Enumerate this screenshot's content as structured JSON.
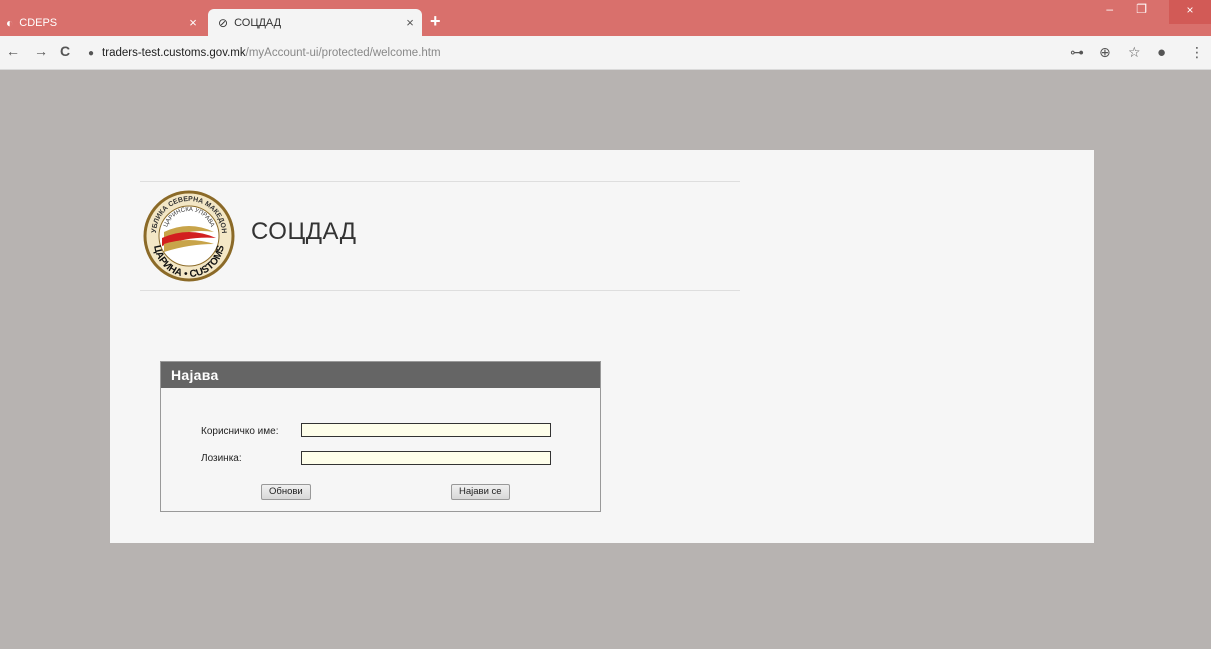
{
  "browser": {
    "tabs": [
      {
        "title": "CDEPS",
        "close": "×"
      },
      {
        "title": "СОЦДАД",
        "close": "×"
      }
    ],
    "new_tab": "+",
    "window_controls": {
      "minimize": "‒",
      "restore": "❐",
      "close": "×"
    },
    "nav": {
      "back": "←",
      "forward": "→",
      "reload": "C"
    },
    "url": {
      "host": "traders-test.customs.gov.mk",
      "path": "/myAccount-ui/protected/welcome.htm"
    },
    "toolbar_icons": {
      "key": "⊶",
      "zoom": "⊕",
      "star": "☆",
      "profile": "●",
      "menu": "⋮"
    }
  },
  "page": {
    "app_title": "СОЦДАД",
    "logo": {
      "top_text": "РЕПУБЛИКА СЕВЕРНА МАКЕДОНИЈА",
      "inner_text": "ЦАРИНСКА УПРАВА",
      "bottom_text": "ЦАРИНА • CUSTOMS"
    },
    "login": {
      "header": "Најава",
      "username_label": "Корисничко име:",
      "username_value": "",
      "password_label": "Лозинка:",
      "password_value": "",
      "refresh_button": "Обнови",
      "submit_button": "Најави се"
    }
  },
  "colors": {
    "tabbar": "#d9706c",
    "background": "#b7b3b1",
    "panel": "#f6f6f6",
    "login_header": "#656565",
    "field_bg": "#fefeea"
  }
}
